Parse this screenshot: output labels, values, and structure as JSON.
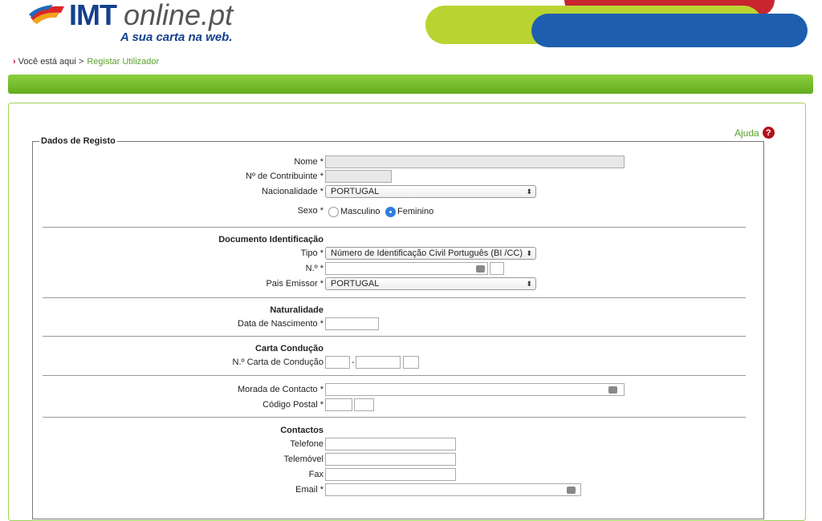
{
  "brand": {
    "imt": "IMT",
    "online": "online.pt",
    "tagline": "A sua carta na web."
  },
  "breadcrumb": {
    "prefix": "Você está aqui >",
    "current": "Registar Utilizador"
  },
  "help": {
    "label": "Ajuda",
    "icon_glyph": "?"
  },
  "form": {
    "legend": "Dados de Registo",
    "nome_label": "Nome *",
    "nif_label": "Nº de Contribuinte *",
    "nacionalidade_label": "Nacionalidade *",
    "nacionalidade_value": "PORTUGAL",
    "sexo_label": "Sexo *",
    "sexo_options": [
      "Masculino",
      "Feminino"
    ],
    "sexo_selected": "Feminino",
    "doc_section": "Documento Identificação",
    "tipo_label": "Tipo *",
    "tipo_value": "Número de Identificação Civil Português (BI /CC)",
    "numero_label": "N.º *",
    "pais_label": "Pais Emissor *",
    "pais_value": "PORTUGAL",
    "nat_section": "Naturalidade",
    "nascimento_label": "Data de Nascimento *",
    "carta_section": "Carta Condução",
    "carta_label": "N.º Carta de Condução",
    "carta_separator": "-",
    "morada_label": "Morada de Contacto *",
    "cp_label": "Código Postal *",
    "contactos_section": "Contactos",
    "telefone_label": "Telefone",
    "telemovel_label": "Telemóvel",
    "fax_label": "Fax",
    "email_label": "Email *"
  },
  "colors": {
    "brand_blue": "#14418c",
    "accent_green": "#64ad1f",
    "help_red": "#b1131c"
  }
}
